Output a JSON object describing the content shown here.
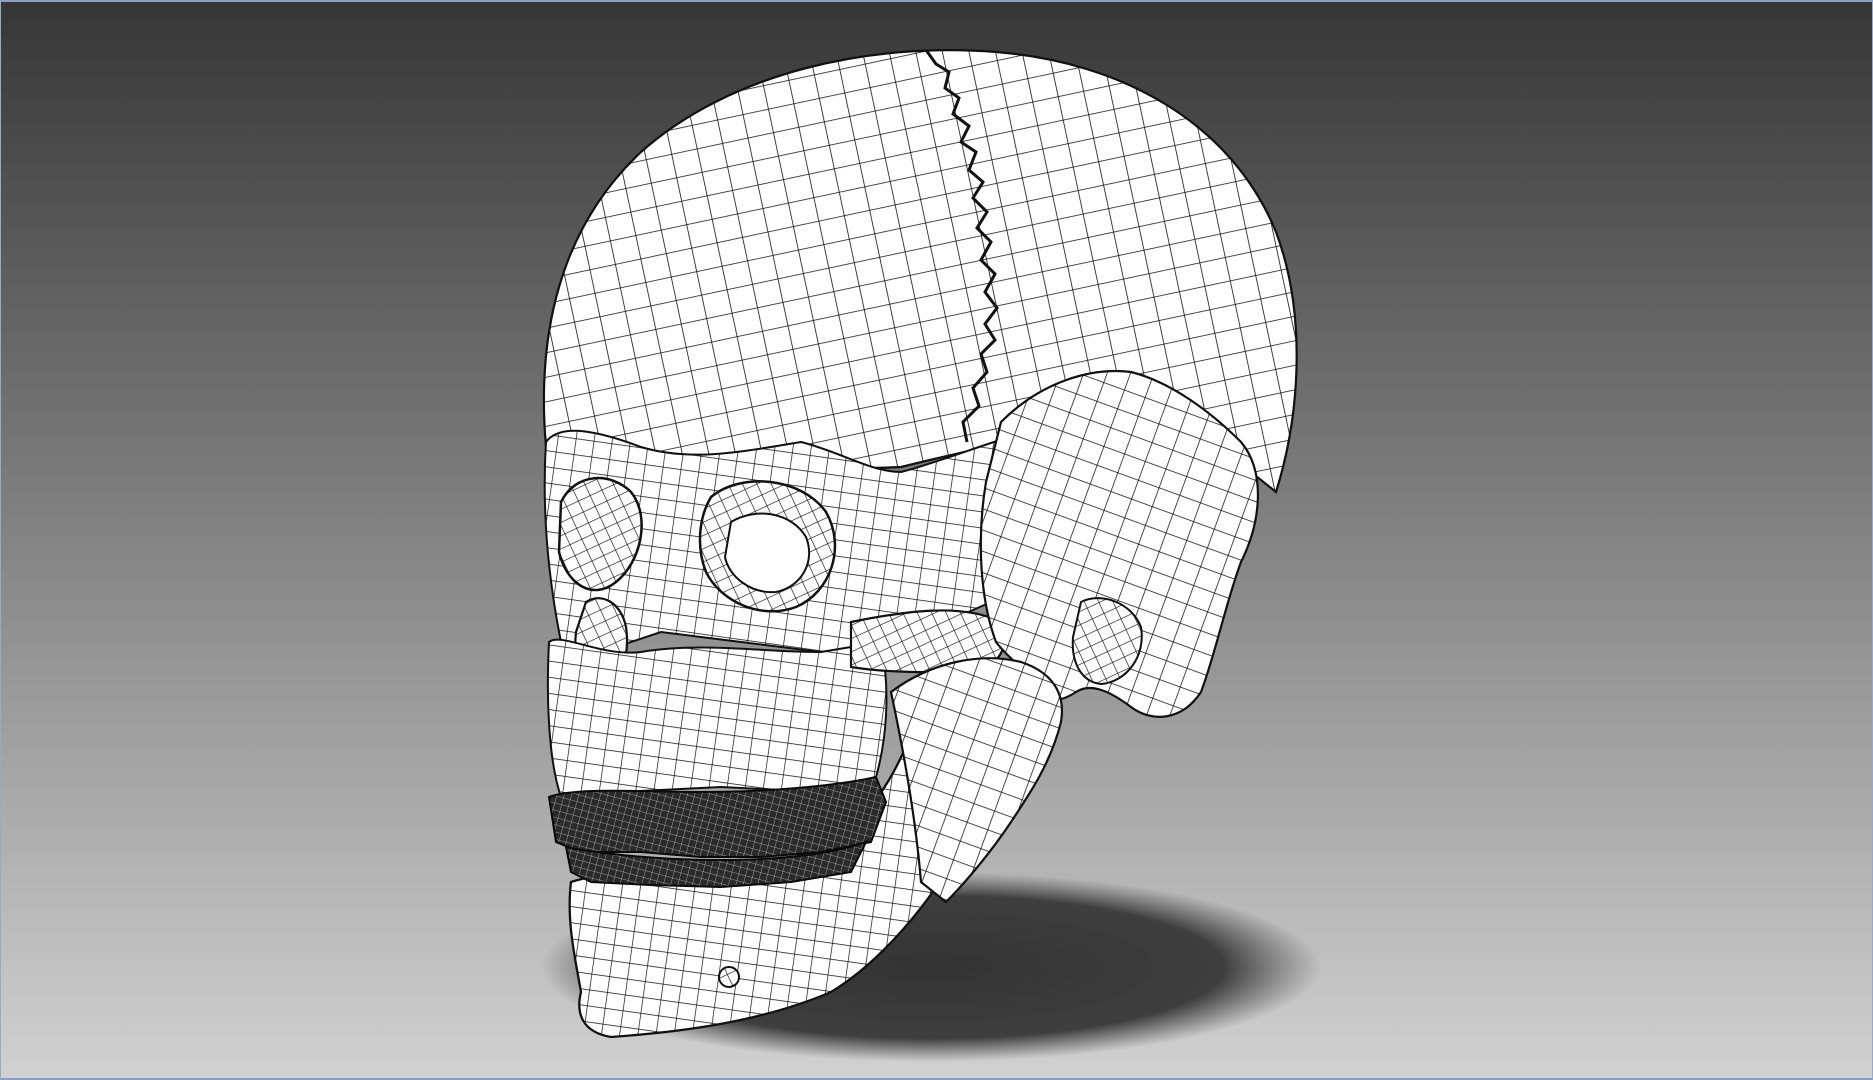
{
  "scene": {
    "subject": "skull-wireframe-mesh",
    "render_style": "white-fill-black-quad-wireframe",
    "colors": {
      "background_top": "#363636",
      "background_bottom": "#d2d2d2",
      "mesh_fill": "#ffffff",
      "mesh_lines": "#111111",
      "teeth": "#151515",
      "shadow": "#3a3a3a",
      "frame_border": "#8aa0c8"
    }
  }
}
